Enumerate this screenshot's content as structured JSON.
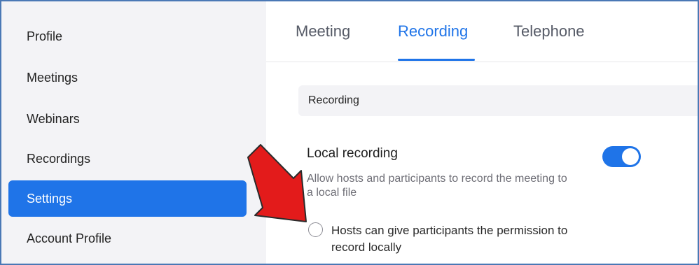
{
  "sidebar": {
    "items": [
      {
        "label": "Profile"
      },
      {
        "label": "Meetings"
      },
      {
        "label": "Webinars"
      },
      {
        "label": "Recordings"
      },
      {
        "label": "Settings",
        "active": true
      },
      {
        "label": "Account Profile"
      }
    ]
  },
  "tabs": [
    {
      "label": "Meeting"
    },
    {
      "label": "Recording",
      "active": true
    },
    {
      "label": "Telephone"
    }
  ],
  "section": {
    "title": "Recording"
  },
  "local_recording": {
    "title": "Local recording",
    "description": "Allow hosts and participants to record the meeting to a local file",
    "enabled": true
  },
  "permission_option": {
    "label": "Hosts can give participants the permission to record locally",
    "checked": false
  },
  "colors": {
    "accent": "#1f74e8",
    "annotation_arrow": "#e31b1b"
  }
}
